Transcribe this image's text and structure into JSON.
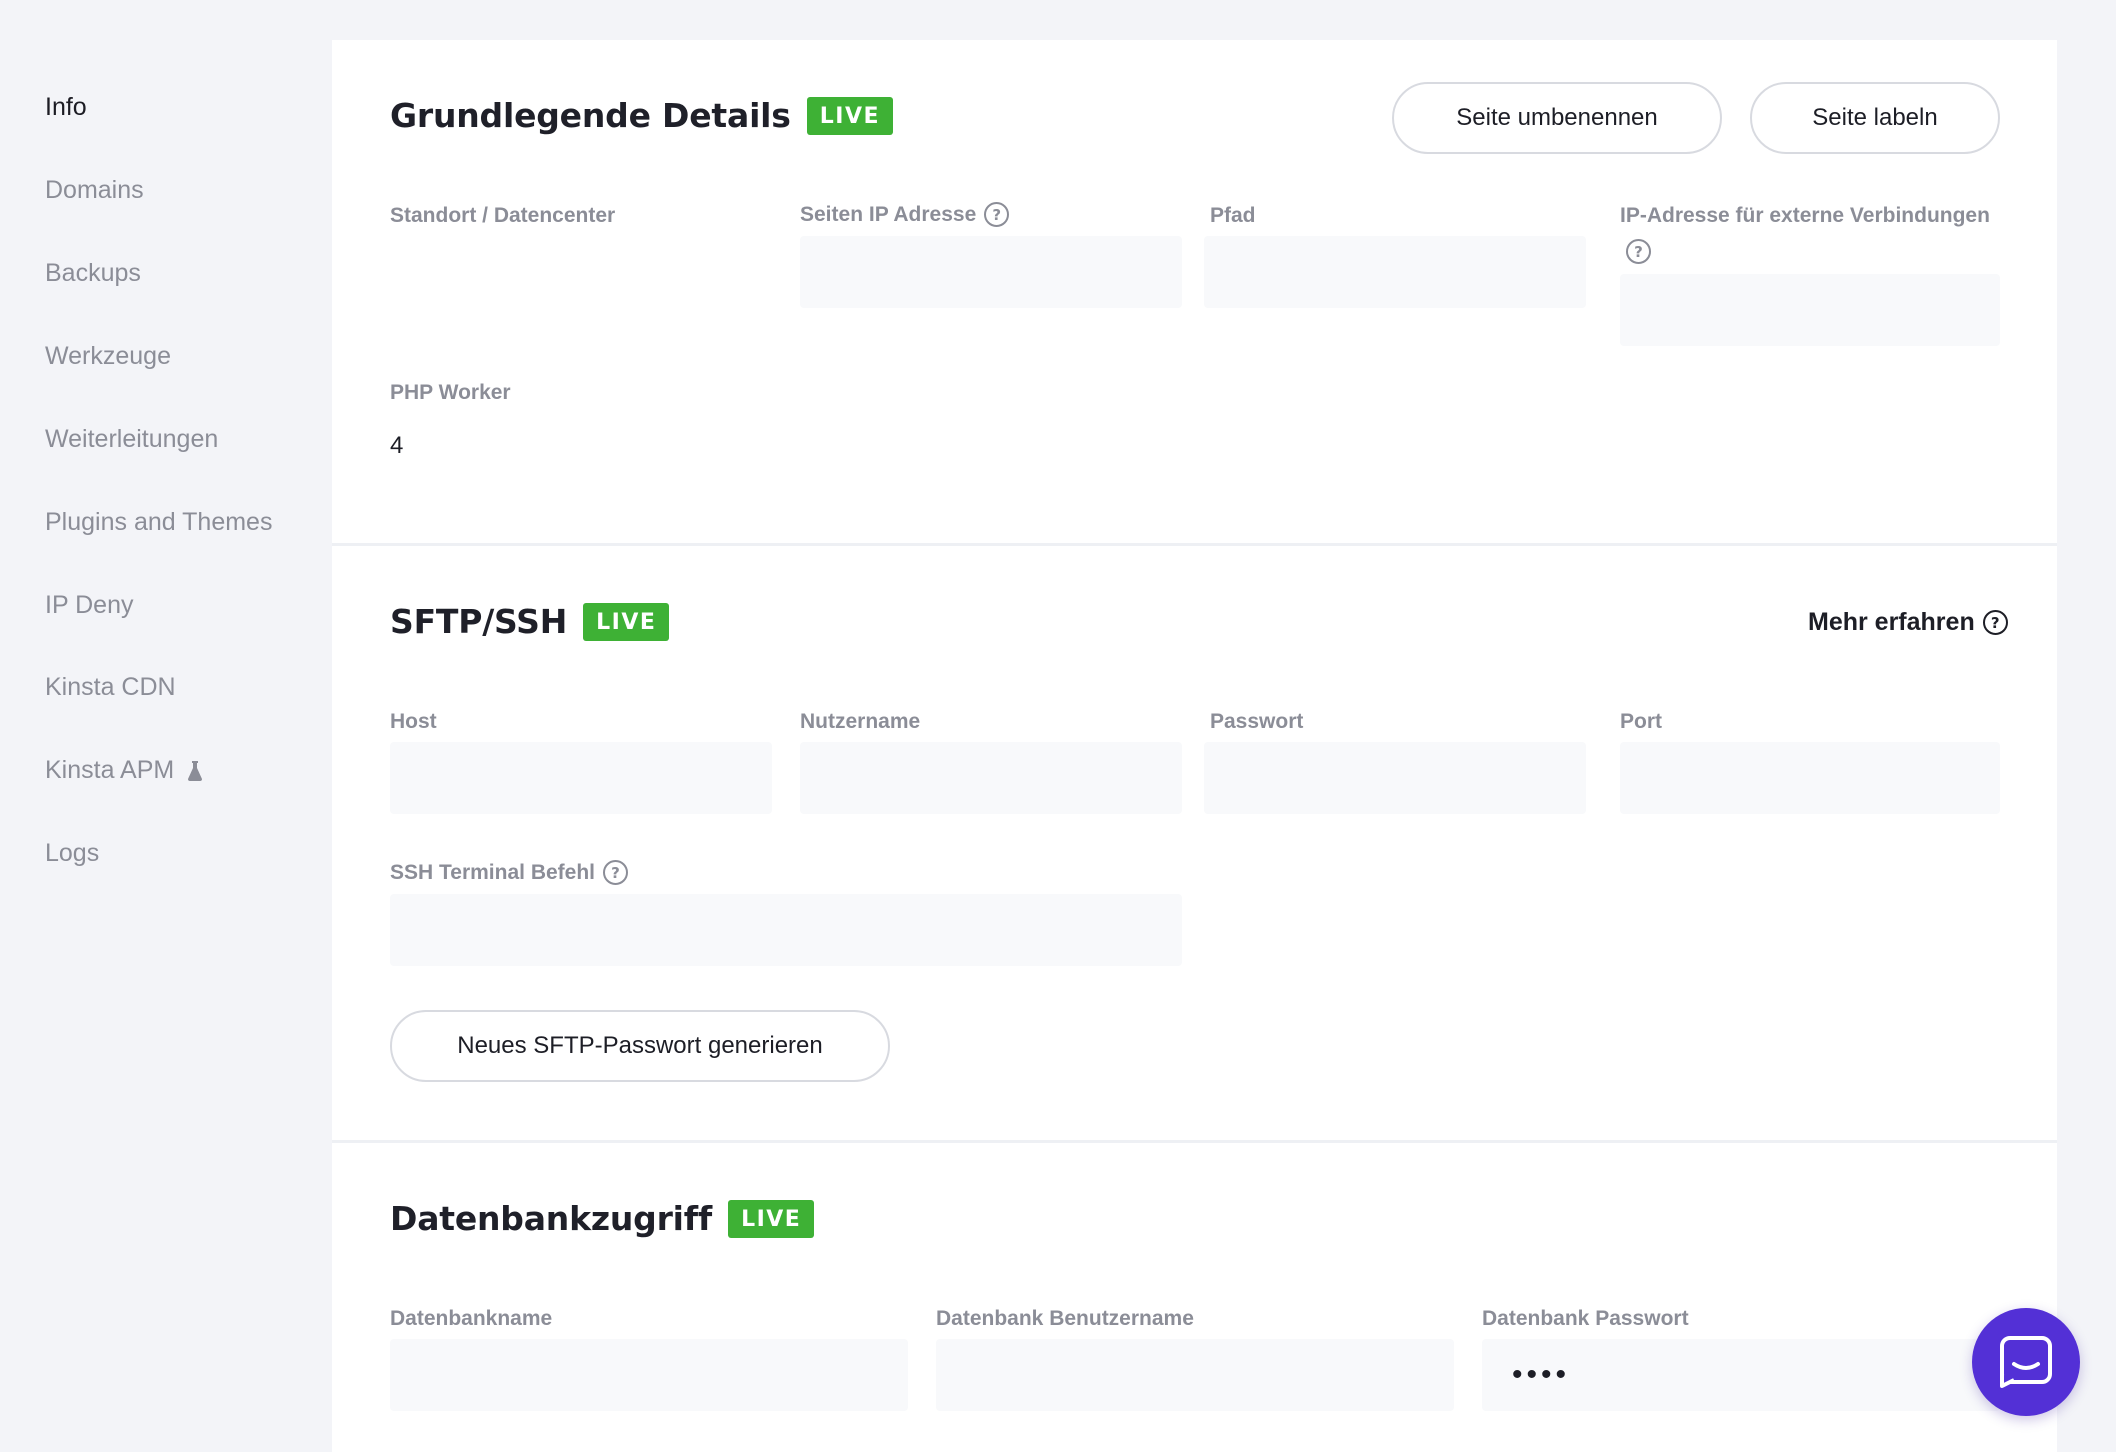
{
  "sidebar": {
    "items": [
      {
        "label": "Info",
        "active": true
      },
      {
        "label": "Domains"
      },
      {
        "label": "Backups"
      },
      {
        "label": "Werkzeuge"
      },
      {
        "label": "Weiterleitungen"
      },
      {
        "label": "Plugins and Themes"
      },
      {
        "label": "IP Deny"
      },
      {
        "label": "Kinsta CDN"
      },
      {
        "label": "Kinsta APM",
        "icon": "flask-icon"
      },
      {
        "label": "Logs"
      }
    ]
  },
  "details": {
    "title": "Grundlegende Details",
    "badge": "LIVE",
    "rename_button": "Seite umbenennen",
    "label_button": "Seite labeln",
    "fields": {
      "location_label": "Standort / Datencenter",
      "ip_label": "Seiten IP Adresse",
      "path_label": "Pfad",
      "external_ip_label": "IP-Adresse für externe Verbindungen",
      "php_workers_label": "PHP Worker",
      "php_workers_value": "4"
    }
  },
  "sftp": {
    "title": "SFTP/SSH",
    "badge": "LIVE",
    "learn_more": "Mehr erfahren",
    "fields": {
      "host_label": "Host",
      "username_label": "Nutzername",
      "password_label": "Passwort",
      "port_label": "Port",
      "ssh_label": "SSH Terminal Befehl"
    },
    "generate_button": "Neues SFTP-Passwort generieren"
  },
  "database": {
    "title": "Datenbankzugriff",
    "badge": "LIVE",
    "fields": {
      "db_name_label": "Datenbankname",
      "db_user_label": "Datenbank Benutzername",
      "db_password_label": "Datenbank Passwort",
      "db_password_value": "••••"
    }
  },
  "colors": {
    "live_badge": "#3eb135",
    "chat_button": "#5330d6",
    "background": "#f3f4f8"
  }
}
